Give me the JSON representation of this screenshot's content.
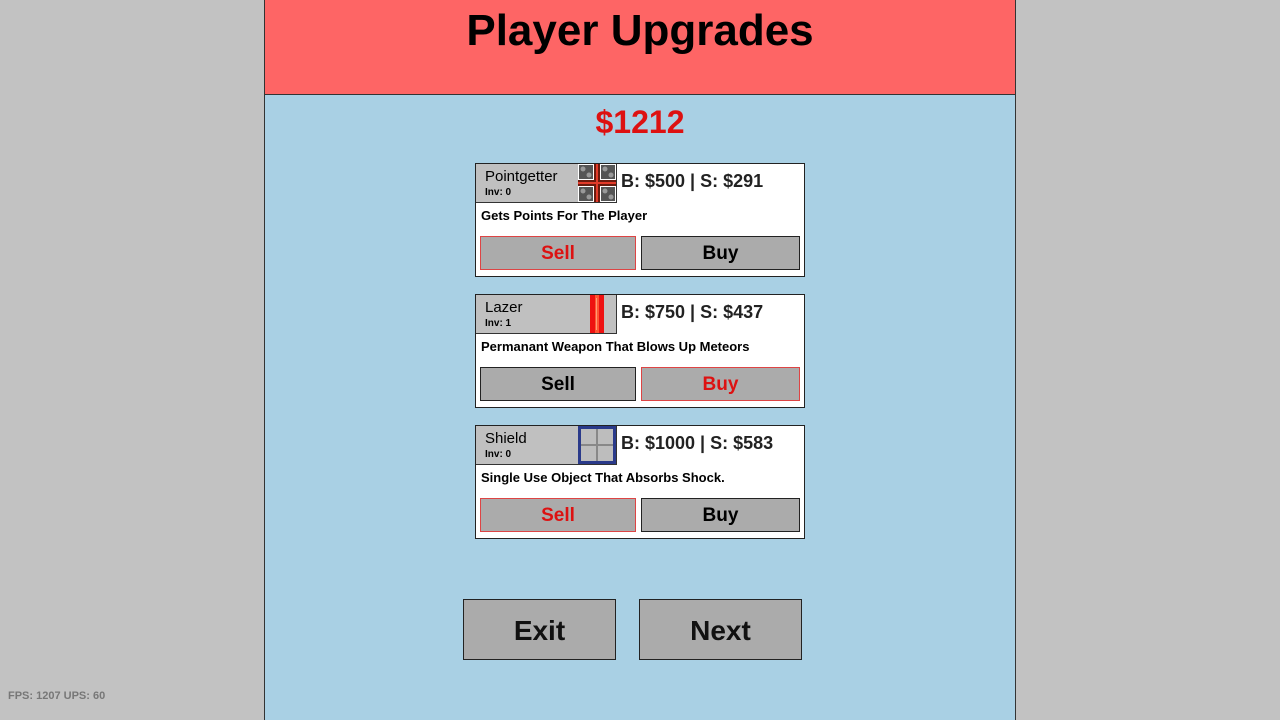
{
  "title": "Player Upgrades",
  "money": "$1212",
  "upgrades": [
    {
      "name": "Pointgetter",
      "inv": "Inv: 0",
      "price": "B: $500 | S: $291",
      "description": "Gets Points For The Player",
      "icon": "pointgetter-icon",
      "sell_label": "Sell",
      "buy_label": "Buy",
      "highlighted": "sell"
    },
    {
      "name": "Lazer",
      "inv": "Inv: 1",
      "price": "B: $750 | S: $437",
      "description": "Permanant Weapon That Blows Up Meteors",
      "icon": "lazer-icon",
      "sell_label": "Sell",
      "buy_label": "Buy",
      "highlighted": "buy"
    },
    {
      "name": "Shield",
      "inv": "Inv: 0",
      "price": "B: $1000 | S: $583",
      "description": "Single Use Object That Absorbs Shock.",
      "icon": "shield-icon",
      "sell_label": "Sell",
      "buy_label": "Buy",
      "highlighted": "sell"
    }
  ],
  "exit_label": "Exit",
  "next_label": "Next",
  "fps_text": "FPS: 1207 UPS: 60",
  "colors": {
    "background": "#c2c2c2",
    "panel": "#a9d0e4",
    "header": "#fe6565",
    "money": "#dd1111",
    "button": "#ababab",
    "highlight": "#dd1111"
  }
}
